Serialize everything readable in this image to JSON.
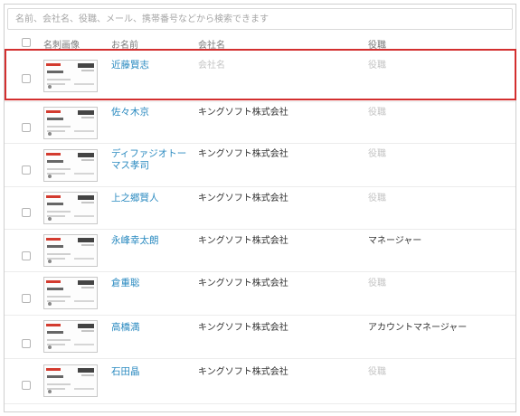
{
  "search": {
    "placeholder": "名前、会社名、役職、メール、携帯番号などから検索できます"
  },
  "columns": {
    "card_image": "名刺画像",
    "name": "お名前",
    "company": "会社名",
    "title": "役職"
  },
  "rows": [
    {
      "name": "近藤賢志",
      "company": "会社名",
      "company_placeholder": true,
      "title": "役職",
      "title_placeholder": true,
      "selected": true
    },
    {
      "name": "佐々木京",
      "company": "キングソフト株式会社",
      "company_placeholder": false,
      "title": "役職",
      "title_placeholder": true
    },
    {
      "name": "ディファジオトーマス孝司",
      "company": "キングソフト株式会社",
      "company_placeholder": false,
      "title": "役職",
      "title_placeholder": true
    },
    {
      "name": "上之郷賢人",
      "company": "キングソフト株式会社",
      "company_placeholder": false,
      "title": "役職",
      "title_placeholder": true
    },
    {
      "name": "永峰幸太朗",
      "company": "キングソフト株式会社",
      "company_placeholder": false,
      "title": "マネージャー",
      "title_placeholder": false
    },
    {
      "name": "倉重聡",
      "company": "キングソフト株式会社",
      "company_placeholder": false,
      "title": "役職",
      "title_placeholder": true
    },
    {
      "name": "高橋満",
      "company": "キングソフト株式会社",
      "company_placeholder": false,
      "title": "アカウントマネージャー",
      "title_placeholder": false
    },
    {
      "name": "石田晶",
      "company": "キングソフト株式会社",
      "company_placeholder": false,
      "title": "役職",
      "title_placeholder": true
    }
  ],
  "colors": {
    "link": "#2a8ac0",
    "highlight": "#d32f2f",
    "placeholder_text": "#c4c4c4"
  }
}
